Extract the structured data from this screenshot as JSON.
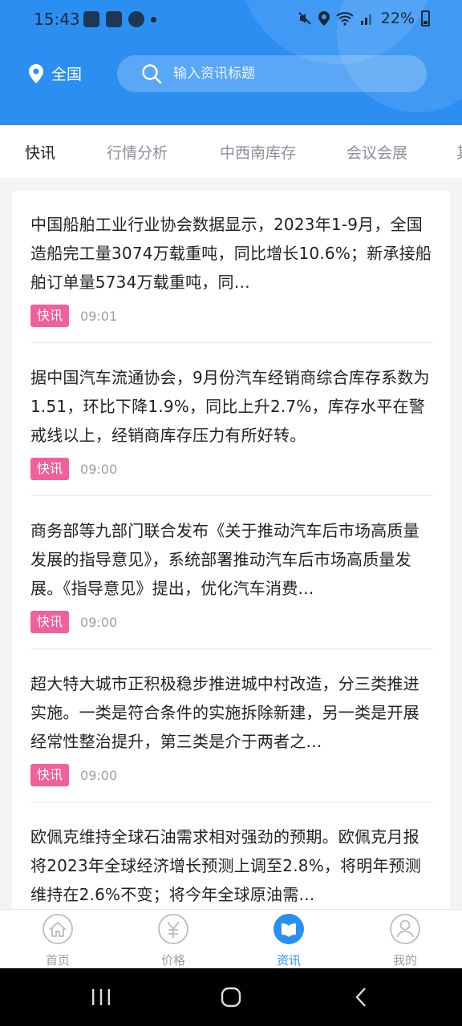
{
  "status_bar": {
    "time": "15:43",
    "battery": "22%"
  },
  "header": {
    "location": "全国",
    "search_placeholder": "输入资讯标题"
  },
  "tabs": [
    {
      "label": "快讯",
      "active": true
    },
    {
      "label": "行情分析",
      "active": false
    },
    {
      "label": "中西南库存",
      "active": false
    },
    {
      "label": "会议会展",
      "active": false
    },
    {
      "label": "其",
      "active": false
    }
  ],
  "news": [
    {
      "text": "中国船舶工业行业协会数据显示，2023年1-9月，全国造船完工量3074万载重吨，同比增长10.6%；新承接船舶订单量5734万载重吨，同…",
      "tag": "快讯",
      "time": "09:01"
    },
    {
      "text": "据中国汽车流通协会，9月份汽车经销商综合库存系数为1.51，环比下降1.9%，同比上升2.7%，库存水平在警戒线以上，经销商库存压力有所好转。",
      "tag": "快讯",
      "time": "09:00"
    },
    {
      "text": "商务部等九部门联合发布《关于推动汽车后市场高质量发展的指导意见》，系统部署推动汽车后市场高质量发展。《指导意见》提出，优化汽车消费…",
      "tag": "快讯",
      "time": "09:00"
    },
    {
      "text": "超大特大城市正积极稳步推进城中村改造，分三类推进实施。一类是符合条件的实施拆除新建，另一类是开展经常性整治提升，第三类是介于两者之…",
      "tag": "快讯",
      "time": "09:00"
    },
    {
      "text": "欧佩克维持全球石油需求相对强劲的预期。欧佩克月报将2023年全球经济增长预测上调至2.8%，将明年预测维持在2.6%不变；将今年全球原油需…",
      "tag": "快讯",
      "time": ""
    }
  ],
  "bottom_nav": [
    {
      "label": "首页",
      "icon": "home-icon",
      "active": false
    },
    {
      "label": "价格",
      "icon": "yuan-icon",
      "active": false
    },
    {
      "label": "资讯",
      "icon": "news-icon",
      "active": true
    },
    {
      "label": "我的",
      "icon": "profile-icon",
      "active": false
    }
  ],
  "colors": {
    "primary": "#2b8ff2",
    "tag": "#f0609a"
  }
}
